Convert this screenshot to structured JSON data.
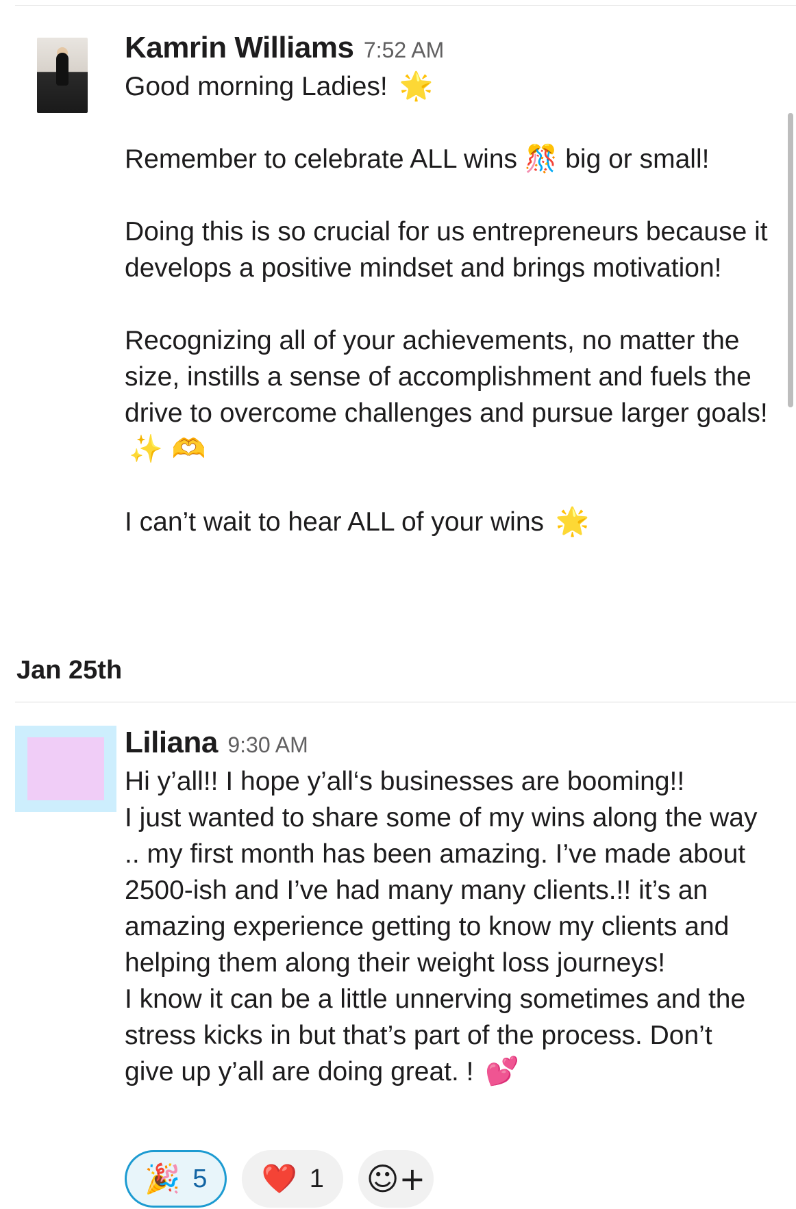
{
  "messages": [
    {
      "author": "Kamrin Williams",
      "time": "7:52 AM",
      "avatar_icon": "profile-photo",
      "paragraphs": [
        {
          "text": "Good morning Ladies!",
          "emoji": "🌟"
        },
        {
          "text": "Remember to celebrate ALL wins 🎊 big or small!",
          "emoji": ""
        },
        {
          "text": "Doing this is so crucial for us entrepreneurs because it develops a positive mindset and brings motivation!",
          "emoji": ""
        },
        {
          "text": "Recognizing all of your achievements, no matter the size, instills a sense of accomplishment and fuels the drive to overcome challenges and pursue larger goals!",
          "emoji": "✨ 🫶"
        },
        {
          "text": "I can’t wait to hear ALL of your wins",
          "emoji": "🌟"
        }
      ]
    },
    {
      "author": "Liliana",
      "time": "9:30 AM",
      "avatar_icon": "placeholder-avatar",
      "lines": [
        "Hi y’all!! I hope y’all‘s businesses are booming!!",
        "I just wanted to share some of my wins along the way .. my first month has been amazing. I’ve made about 2500-ish and I’ve had many many clients.!! it’s an amazing experience getting to know my clients and helping them along their weight loss journeys!",
        "I know it can be a little unnerving sometimes and the stress kicks in but that’s part of the process. Don’t give up y’all are doing great. !"
      ],
      "trailing_emoji": "💕"
    }
  ],
  "date_divider": "Jan 25th",
  "reactions": [
    {
      "emoji": "🎉",
      "count": "5",
      "active": true
    },
    {
      "emoji": "❤️",
      "count": "1",
      "active": false
    },
    {
      "emoji": "☺+",
      "count": "",
      "active": false,
      "icon": "add-reaction-icon"
    }
  ],
  "colors": {
    "active_reaction_border": "#1d9bd1",
    "active_reaction_bg": "#e8f5fa",
    "avatar2_outer": "#cdeefd",
    "avatar2_inner": "#f0cdf7"
  }
}
